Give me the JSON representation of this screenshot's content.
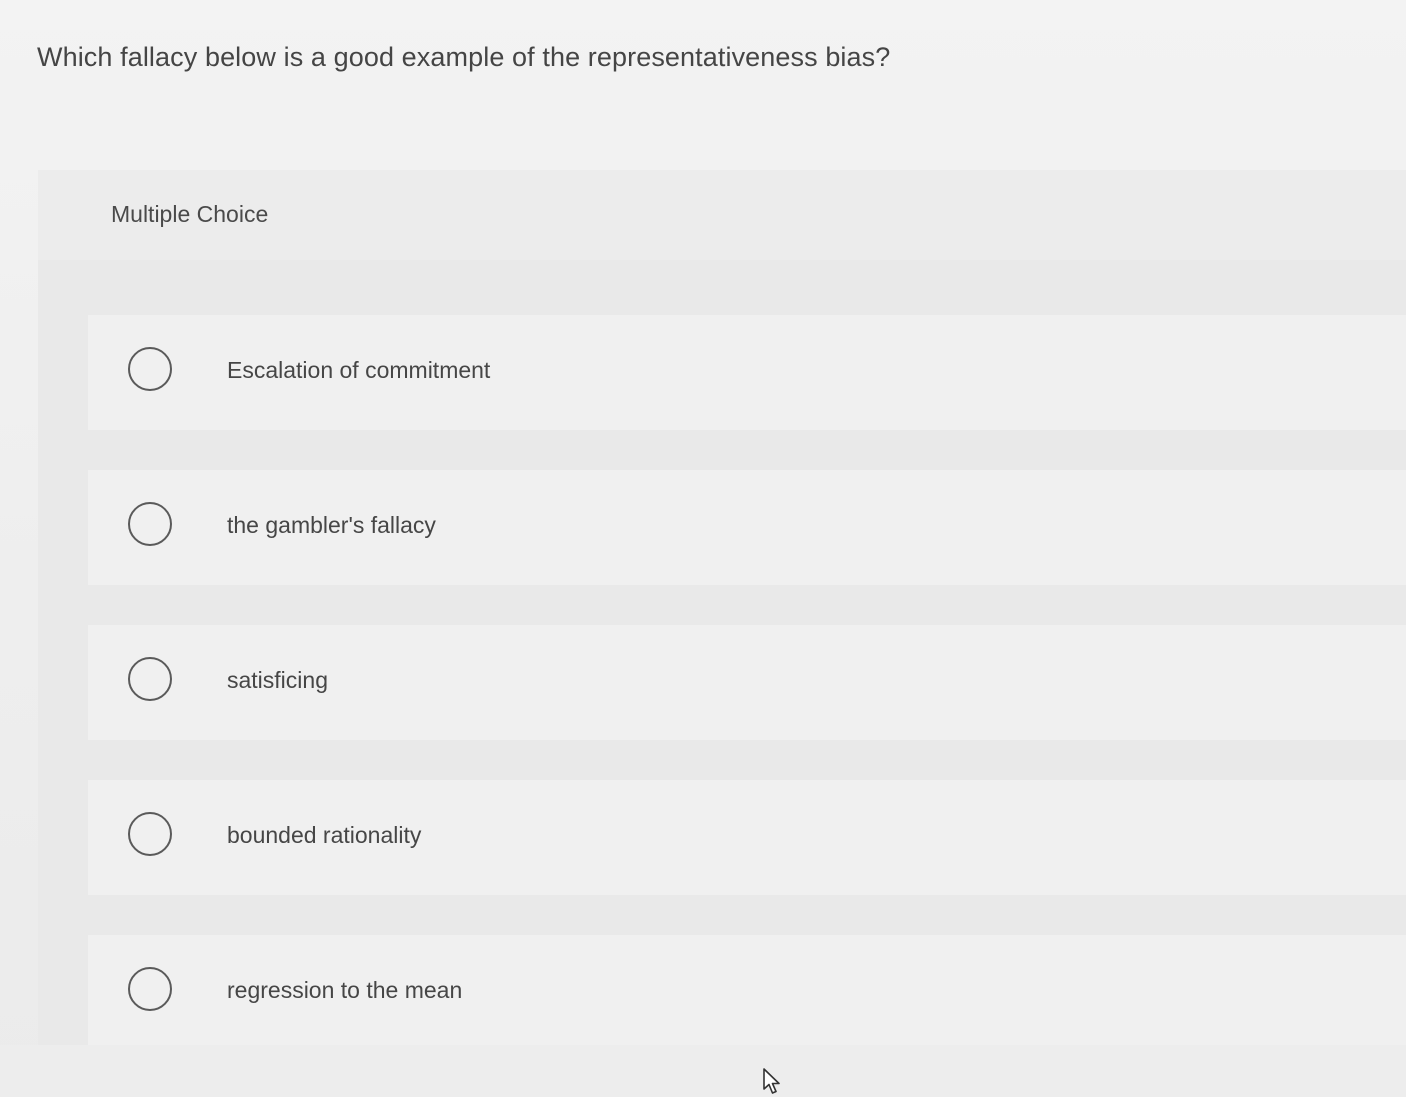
{
  "question": {
    "text": "Which fallacy below is a good example of the representativeness bias?"
  },
  "multiple_choice": {
    "label": "Multiple Choice",
    "options": [
      {
        "label": "Escalation of commitment",
        "selected": false
      },
      {
        "label": "the gambler's fallacy",
        "selected": false
      },
      {
        "label": "satisficing",
        "selected": false
      },
      {
        "label": "bounded rationality",
        "selected": false
      },
      {
        "label": "regression to the mean",
        "selected": false
      }
    ]
  },
  "icons": {
    "radio": "radio-unchecked-icon",
    "cursor": "mouse-pointer-icon"
  },
  "colors": {
    "background": "#eeeeee",
    "panel": "#e9e9e9",
    "option_bg": "#f0f0f0",
    "text": "#464646",
    "radio_border": "#5a5a5a"
  }
}
